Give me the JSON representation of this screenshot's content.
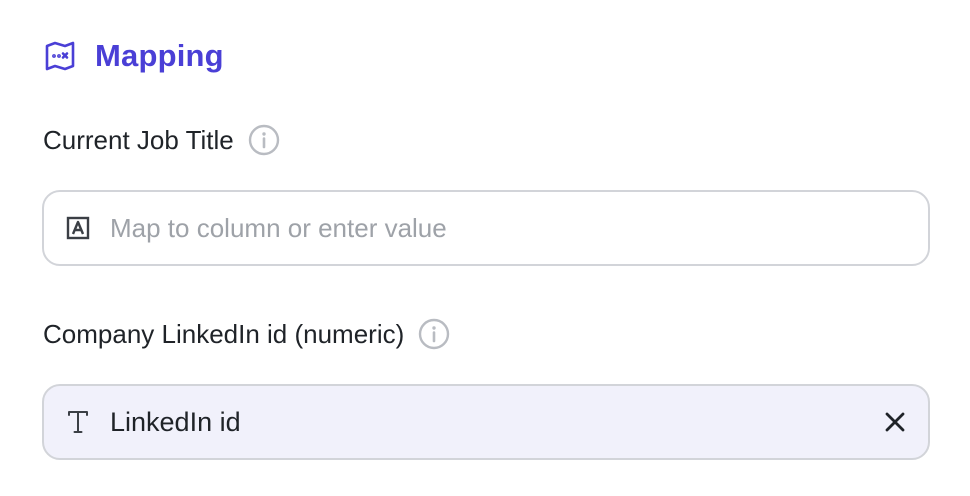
{
  "section": {
    "title": "Mapping",
    "icon": "map-icon",
    "accent_color": "#4a3fd6"
  },
  "fields": [
    {
      "label": "Current Job Title",
      "info_icon": "info-icon",
      "type_icon": "text-box-a-icon",
      "value": "",
      "placeholder": "Map to column or enter value"
    },
    {
      "label": "Company LinkedIn id (numeric)",
      "info_icon": "info-icon",
      "type_icon": "text-type-t-icon",
      "value": "LinkedIn id",
      "clear_icon": "close-icon"
    }
  ]
}
